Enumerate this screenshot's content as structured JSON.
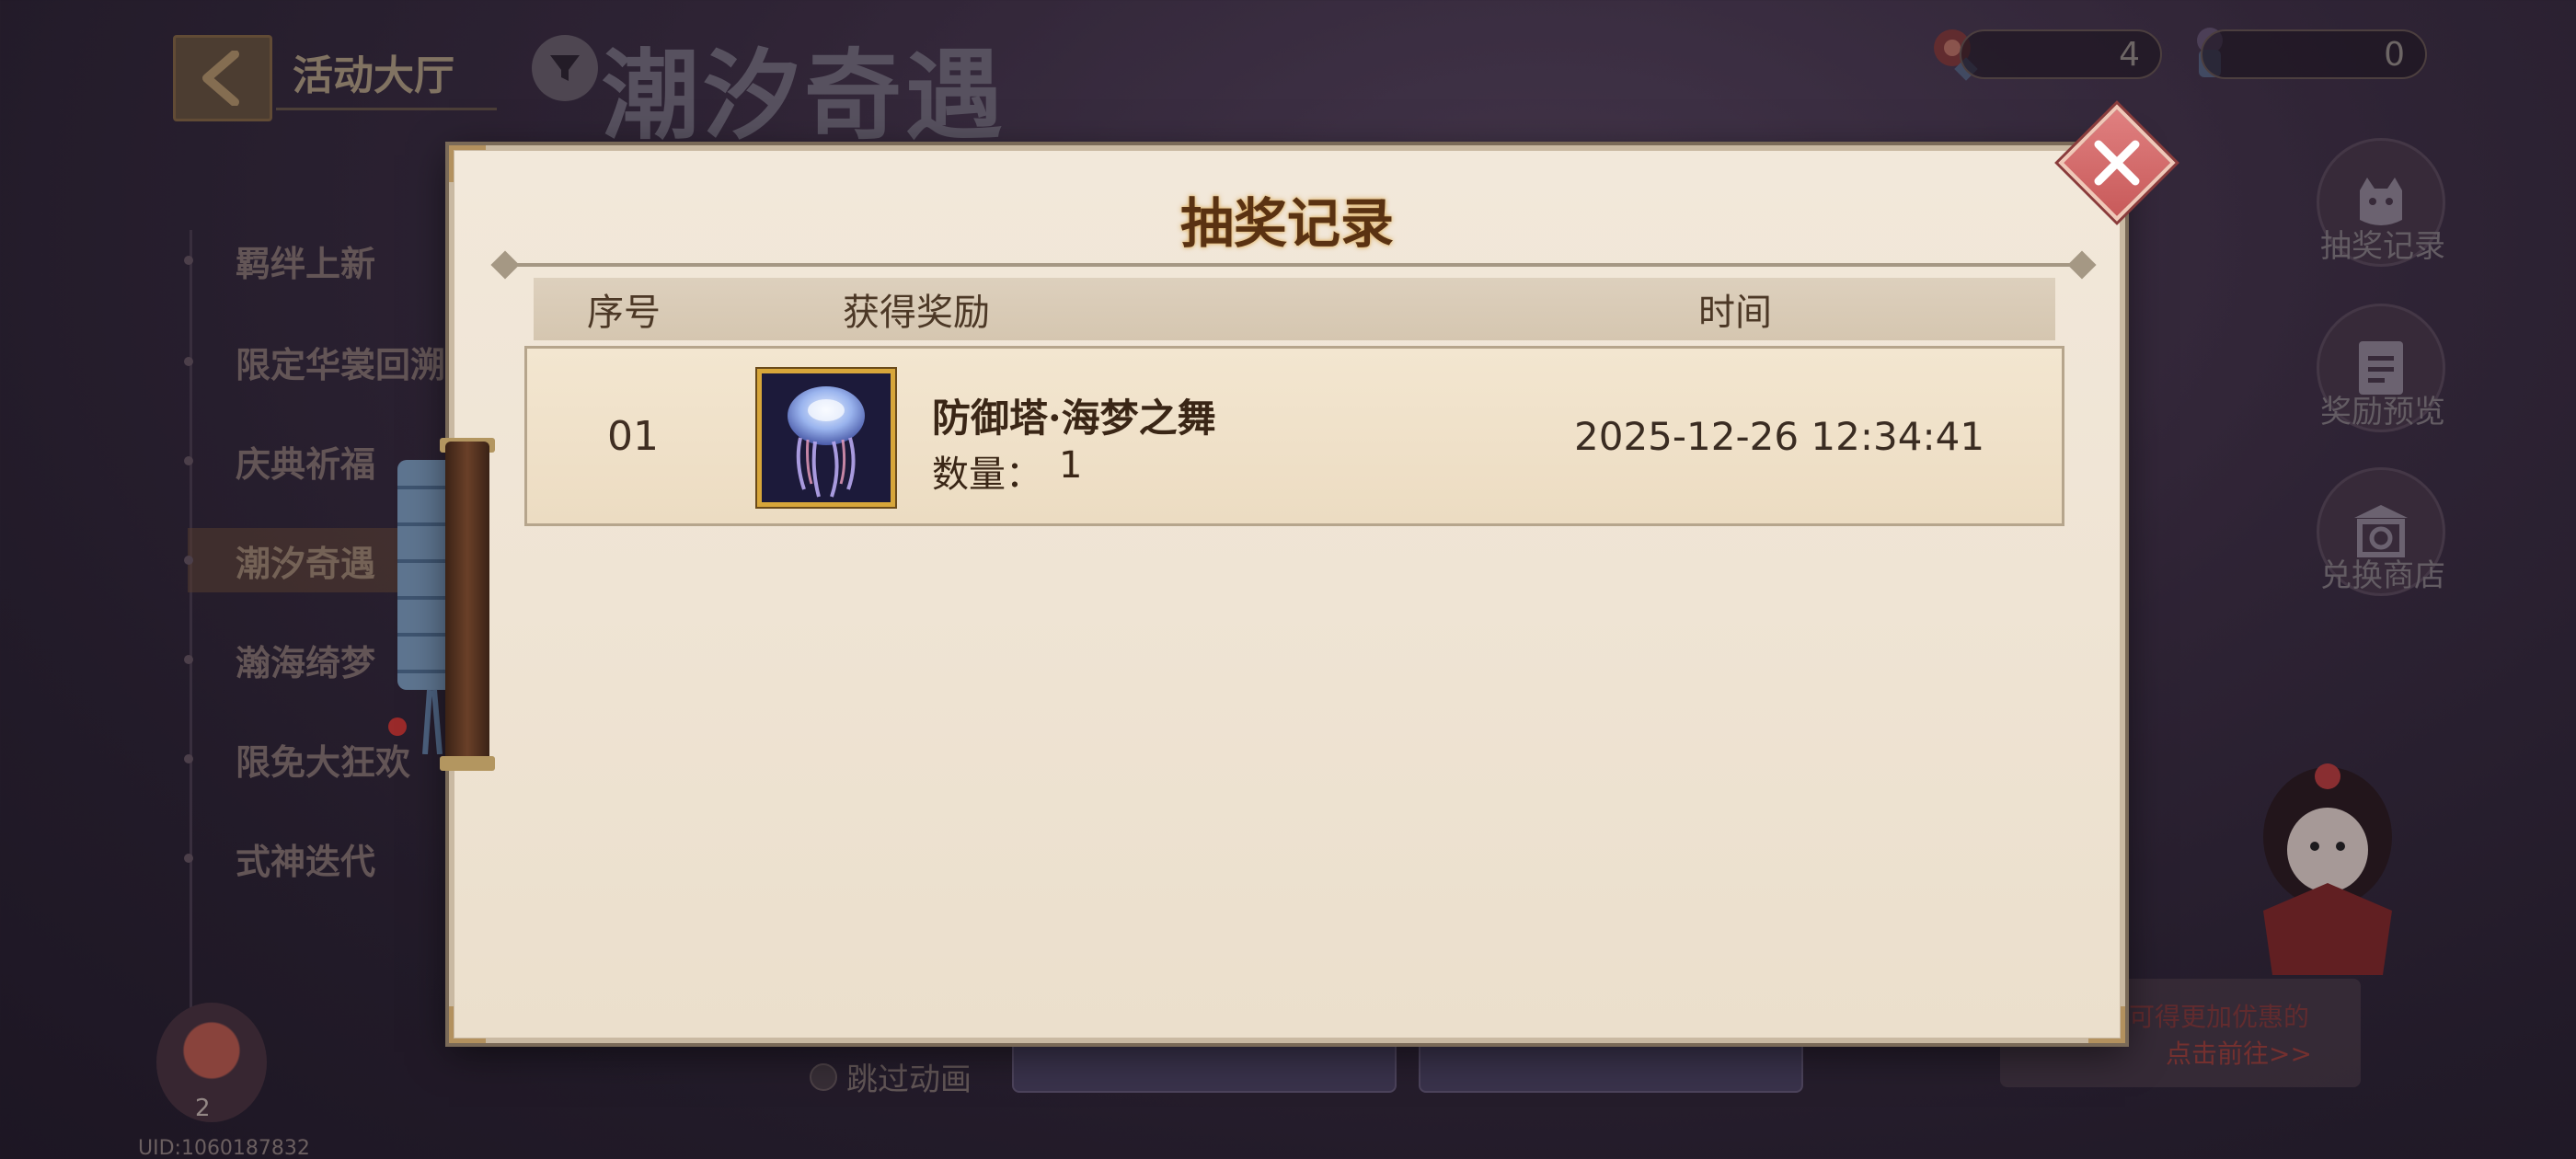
{
  "header": {
    "hall_label": "活动大厅",
    "page_title": "潮汐奇遇",
    "currency_1": "4",
    "currency_2": "0"
  },
  "left_menu": {
    "items": [
      {
        "label": "羁绊上新"
      },
      {
        "label": "限定华裳回溯"
      },
      {
        "label": "庆典祈福"
      },
      {
        "label": "潮汐奇遇"
      },
      {
        "label": "瀚海绮梦"
      },
      {
        "label": "限免大狂欢"
      },
      {
        "label": "式神迭代"
      }
    ],
    "active_index": 3
  },
  "right_panel": {
    "buttons": [
      {
        "label": "抽奖记录",
        "icon": "cat-icon"
      },
      {
        "label": "奖励预览",
        "icon": "document-icon"
      },
      {
        "label": "兑换商店",
        "icon": "shop-icon"
      }
    ]
  },
  "bottom": {
    "skip_animation": "跳过动画",
    "promo_line1": "可得更加优惠的",
    "promo_line2": "点击前往>>"
  },
  "user": {
    "uid": "UID:1060187832",
    "badge": "2"
  },
  "modal": {
    "title": "抽奖记录",
    "columns": {
      "index": "序号",
      "reward": "获得奖励",
      "time": "时间"
    },
    "records": [
      {
        "index": "01",
        "item_name": "防御塔·海梦之舞",
        "quantity_label": "数量：",
        "quantity": "1",
        "time": "2025-12-26 12:34:41",
        "icon": "jellyfish-icon"
      }
    ]
  },
  "colors": {
    "modal_bg": "#efe4d4",
    "title_text": "#5a3212",
    "close_button": "#d06a6a",
    "item_frame": "#d7a63a"
  }
}
